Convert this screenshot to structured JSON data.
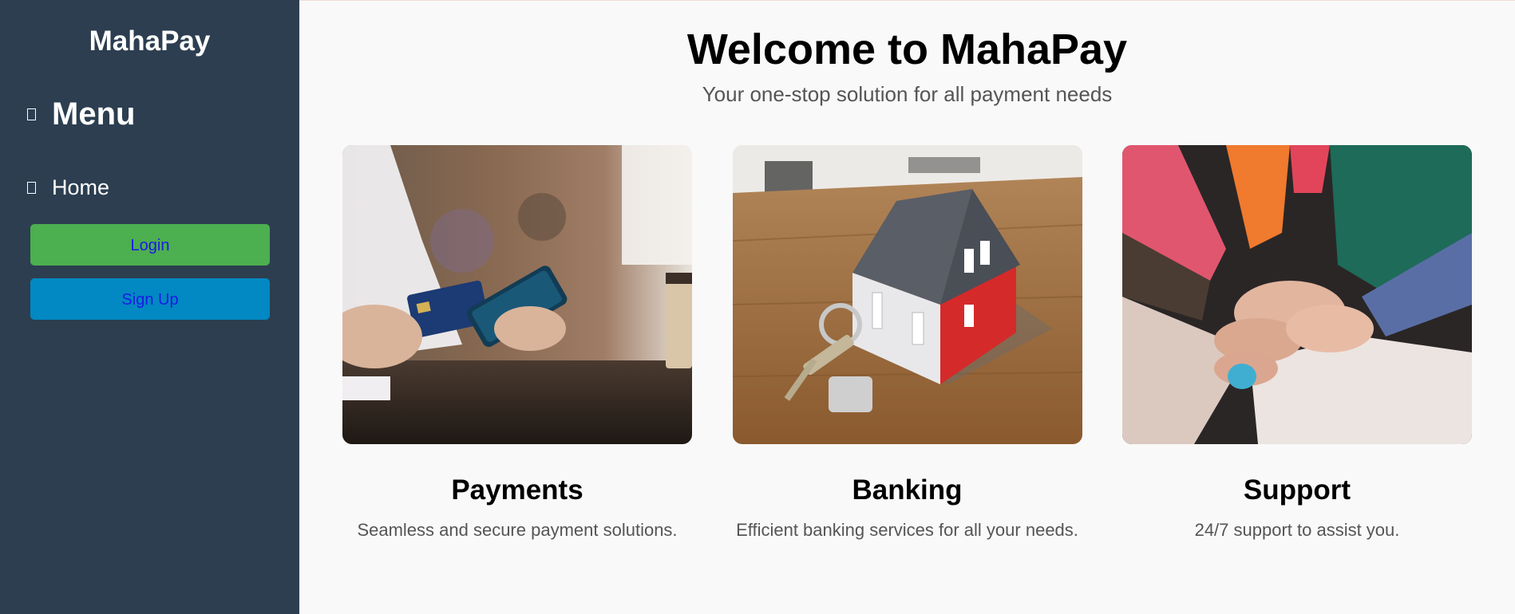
{
  "sidebar": {
    "brand": "MahaPay",
    "menu_icon": "box-icon",
    "menu_title": "Menu",
    "home_icon": "box-icon",
    "home_label": "Home",
    "login_label": "Login",
    "signup_label": "Sign Up"
  },
  "main": {
    "title": "Welcome to MahaPay",
    "subtitle": "Your one-stop solution for all payment needs",
    "cards": [
      {
        "title": "Payments",
        "description": "Seamless and secure payment solutions."
      },
      {
        "title": "Banking",
        "description": "Efficient banking services for all your needs."
      },
      {
        "title": "Support",
        "description": "24/7 support to assist you."
      }
    ]
  },
  "colors": {
    "sidebar_bg": "#2c3e50",
    "login_bg": "#4caf50",
    "signup_bg": "#0288c2",
    "button_text": "#1a1ae6"
  }
}
